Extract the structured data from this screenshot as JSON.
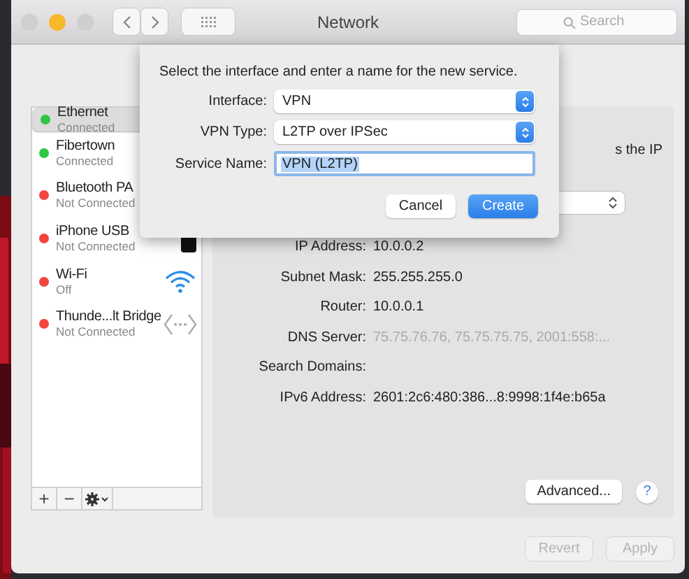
{
  "window": {
    "title": "Network"
  },
  "search": {
    "placeholder": "Search"
  },
  "services": [
    {
      "name": "Ethernet",
      "status": "Connected",
      "color": "#2fc545",
      "selected": true,
      "kind": "plain"
    },
    {
      "name": "Fibertown",
      "status": "Connected",
      "color": "#2fc545",
      "selected": false,
      "kind": "plain"
    },
    {
      "name": "Bluetooth PA",
      "status": "Not Connected",
      "color": "#f2453e",
      "selected": false,
      "kind": "plain"
    },
    {
      "name": "iPhone USB",
      "status": "Not Connected",
      "color": "#f2453e",
      "selected": false,
      "kind": "phone"
    },
    {
      "name": "Wi-Fi",
      "status": "Off",
      "color": "#f2453e",
      "selected": false,
      "kind": "wifi"
    },
    {
      "name": "Thunde...lt Bridge",
      "status": "Not Connected",
      "color": "#f2453e",
      "selected": false,
      "kind": "bridge"
    }
  ],
  "list_toolbar": {
    "add": "+",
    "remove": "−"
  },
  "panel": {
    "hint_fragment": "s the IP",
    "details": [
      {
        "label": "IP Address:",
        "value": "10.0.0.2",
        "dimmed": false
      },
      {
        "label": "Subnet Mask:",
        "value": "255.255.255.0",
        "dimmed": false
      },
      {
        "label": "Router:",
        "value": "10.0.0.1",
        "dimmed": false
      },
      {
        "label": "DNS Server:",
        "value": "75.75.76.76, 75.75.75.75, 2001:558:...",
        "dimmed": true
      },
      {
        "label": "Search Domains:"
      },
      {
        "label": "IPv6 Address:",
        "value": "2601:2c6:480:386...8:9998:1f4e:b65a",
        "dimmed": false
      }
    ],
    "advanced_button": "Advanced...",
    "help_button": "?"
  },
  "footer_buttons": [
    {
      "label": "Revert",
      "disabled": true
    },
    {
      "label": "Apply",
      "disabled": true
    }
  ],
  "dialog": {
    "prompt": "Select the interface and enter a name for the new service.",
    "fields": [
      {
        "label": "Interface:",
        "kind": "select",
        "value": "VPN"
      },
      {
        "label": "VPN Type:",
        "kind": "select",
        "value": "L2TP over IPSec"
      },
      {
        "label": "Service Name:",
        "kind": "text",
        "value": "VPN (L2TP)",
        "text_selected": true
      }
    ],
    "buttons": [
      {
        "label": "Cancel",
        "default": false
      },
      {
        "label": "Create",
        "default": true
      }
    ]
  }
}
